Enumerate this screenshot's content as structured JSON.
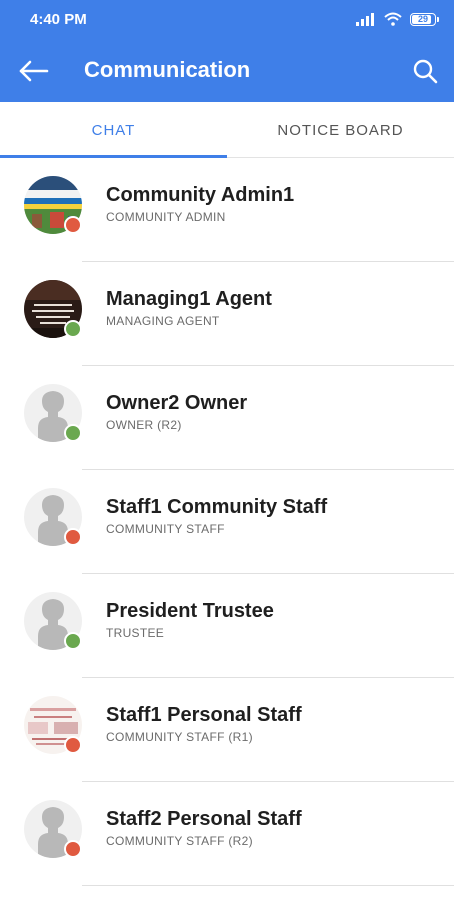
{
  "status_bar": {
    "time": "4:40 PM",
    "battery_level": "29",
    "icons": [
      "signal-icon",
      "wifi-icon",
      "battery-icon"
    ]
  },
  "app_bar": {
    "title": "Communication",
    "back_icon": "arrow-left-icon",
    "search_icon": "search-icon"
  },
  "tabs": {
    "items": [
      {
        "label": "CHAT",
        "selected": true
      },
      {
        "label": "NOTICE BOARD",
        "selected": false
      }
    ]
  },
  "colors": {
    "primary": "#3f7fe8",
    "online": "#6aa84f",
    "offline": "#e05a40"
  },
  "chats": [
    {
      "name": "Community Admin1",
      "role": "COMMUNITY ADMIN",
      "status": "offline",
      "avatar": "photo-banner"
    },
    {
      "name": "Managing1 Agent",
      "role": "MANAGING AGENT",
      "status": "online",
      "avatar": "photo-dark"
    },
    {
      "name": "Owner2 Owner",
      "role": "OWNER (R2)",
      "status": "online",
      "avatar": "placeholder"
    },
    {
      "name": "Staff1 Community Staff",
      "role": "COMMUNITY STAFF",
      "status": "offline",
      "avatar": "placeholder"
    },
    {
      "name": "President Trustee",
      "role": "TRUSTEE",
      "status": "online",
      "avatar": "placeholder"
    },
    {
      "name": "Staff1 Personal Staff",
      "role": "COMMUNITY STAFF (R1)",
      "status": "offline",
      "avatar": "photo-light"
    },
    {
      "name": "Staff2 Personal Staff",
      "role": "COMMUNITY STAFF (R2)",
      "status": "offline",
      "avatar": "placeholder"
    }
  ]
}
